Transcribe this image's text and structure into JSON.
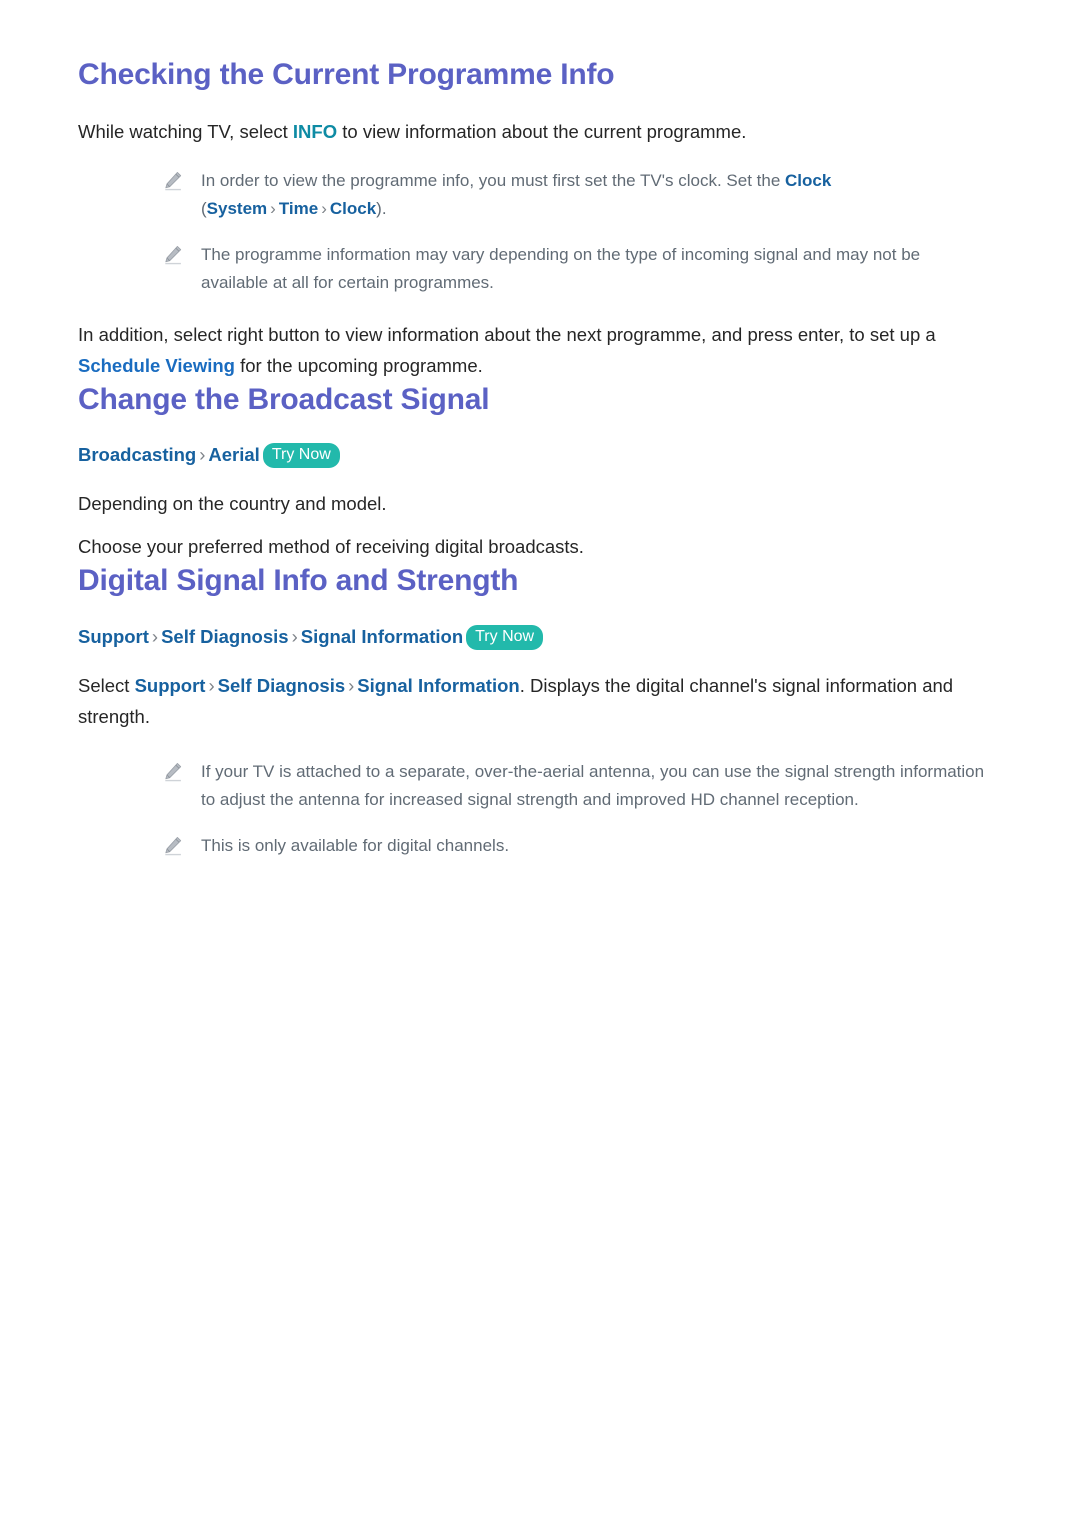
{
  "document": {
    "background": "#ffffff",
    "heading_color": "#5b61c4",
    "menu_color": "#17619f",
    "body_color": "#262626",
    "note_color": "#616b75",
    "badge_color": "#22b9ab",
    "info_key_color": "#0e8ba4"
  },
  "sections": [
    {
      "id": "checking-current-programme-info",
      "title": "Checking the Current Programme Info",
      "intro": {
        "before": "While watching TV, select ",
        "key": "INFO",
        "after": " to view information about the current programme."
      },
      "notes": [
        {
          "icon": "pencil-icon",
          "p1": "In order to view the programme info, you must first set the TV's clock. Set the ",
          "m1": "Clock",
          "p2": " (",
          "m2": "System",
          "chev1": "›",
          "m3": "Time",
          "chev2": "›",
          "m4": "Clock",
          "p3": ")."
        },
        {
          "icon": "pencil-icon",
          "text": "The programme information may vary depending on the type of incoming signal and may not be available at all for certain programmes."
        }
      ],
      "outro": {
        "before": "In addition, select right button to view information about the next programme, and press enter, to set up a ",
        "key": "Schedule Viewing",
        "after": " for the upcoming programme."
      }
    },
    {
      "id": "change-the-broadcast-signal",
      "title": "Change the Broadcast Signal",
      "path": {
        "segments": [
          "Broadcasting",
          "Aerial"
        ],
        "chevron": "›",
        "badge": "Try Now"
      },
      "paragraphs": [
        "Depending on the country and model.",
        "Choose your preferred method of receiving digital broadcasts."
      ]
    },
    {
      "id": "digital-signal-info-and-strength",
      "title": "Digital Signal Info and Strength",
      "path": {
        "segments": [
          "Support",
          "Self Diagnosis",
          "Signal Information"
        ],
        "chevron": "›",
        "badge": "Try Now"
      },
      "select_line": {
        "lead": "Select ",
        "m1": "Support",
        "chev1": "›",
        "m2": "Self Diagnosis",
        "chev2": "›",
        "m3": "Signal Information",
        "tail": ". Displays the digital channel's signal information and strength."
      },
      "notes": [
        {
          "icon": "pencil-icon",
          "text": "If your TV is attached to a separate, over-the-aerial antenna, you can use the signal strength information to adjust the antenna for increased signal strength and improved HD channel reception."
        },
        {
          "icon": "pencil-icon",
          "text": "This is only available for digital channels."
        }
      ]
    }
  ]
}
